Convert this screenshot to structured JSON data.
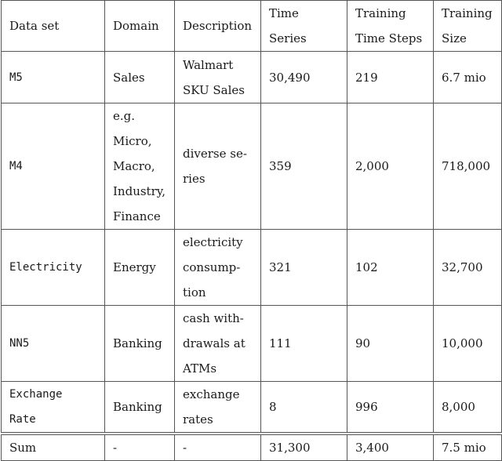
{
  "table": {
    "headers": [
      "Data set",
      "Domain",
      "Description",
      "Time Series",
      "Training\nTime Steps",
      "Training\nSize"
    ],
    "rows": [
      {
        "dataset": "M5",
        "domain": "Sales",
        "description": "Walmart\nSKU Sales",
        "time_series": "30,490",
        "training_time_steps": "219",
        "training_size": "6.7 mio"
      },
      {
        "dataset": "M4",
        "domain": "e.g.\nMicro,\nMacro,\nIndustry,\nFinance",
        "description": "diverse se-\nries",
        "time_series": "359",
        "training_time_steps": "2,000",
        "training_size": "718,000"
      },
      {
        "dataset": "Electricity",
        "domain": "Energy",
        "description": "electricity\nconsump-\ntion",
        "time_series": "321",
        "training_time_steps": "102",
        "training_size": "32,700"
      },
      {
        "dataset": "NN5",
        "domain": "Banking",
        "description": "cash with-\ndrawals at\nATMs",
        "time_series": "111",
        "training_time_steps": "90",
        "training_size": "10,000"
      },
      {
        "dataset": "Exchange\nRate",
        "domain": "Banking",
        "description": "exchange\nrates",
        "time_series": "8",
        "training_time_steps": "996",
        "training_size": "8,000"
      }
    ],
    "sum": {
      "label": "Sum",
      "domain": "-",
      "description": "-",
      "time_series": "31,300",
      "training_time_steps": "3,400",
      "training_size": "7.5 mio"
    }
  }
}
